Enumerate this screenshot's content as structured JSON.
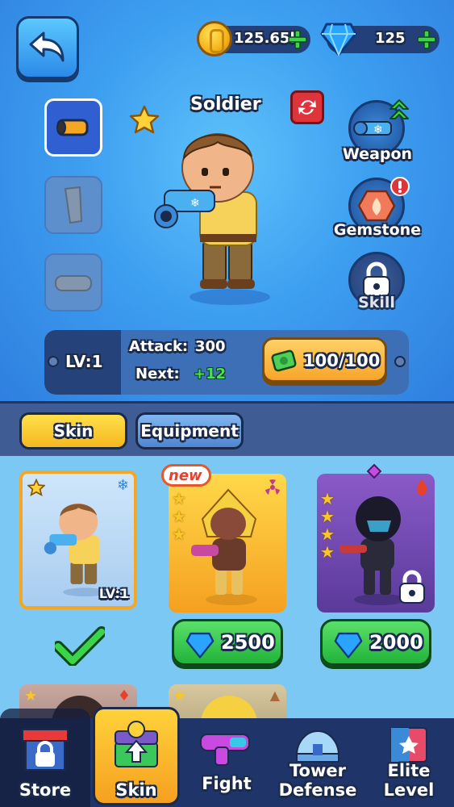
{
  "header": {
    "back_icon": "back-arrow-icon",
    "coins": "125.65k",
    "gems": "125"
  },
  "hero": {
    "name": "Soldier",
    "level_label": "LV:1",
    "attack_label": "Attack:",
    "attack_value": "300",
    "next_label": "Next:",
    "next_value": "+12",
    "upgrade_cost": "100/100"
  },
  "right_menu": {
    "weapon": "Weapon",
    "gemstone": "Gemstone",
    "skill": "Skill"
  },
  "tabs": {
    "skin": "Skin",
    "equipment": "Equipment"
  },
  "skins": [
    {
      "level": "LV:1",
      "status": "owned"
    },
    {
      "badge": "new",
      "price": "2500"
    },
    {
      "price": "2000",
      "status": "locked"
    }
  ],
  "nav": {
    "store": "Store",
    "skin": "Skin",
    "fight": "Fight",
    "tower_line1": "Tower",
    "tower_line2": "Defense",
    "elite_line1": "Elite",
    "elite_line2": "Level"
  },
  "colors": {
    "accent_yellow": "#ffd23a",
    "price_green": "#22b43a",
    "panel_blue": "#3f5c95"
  }
}
